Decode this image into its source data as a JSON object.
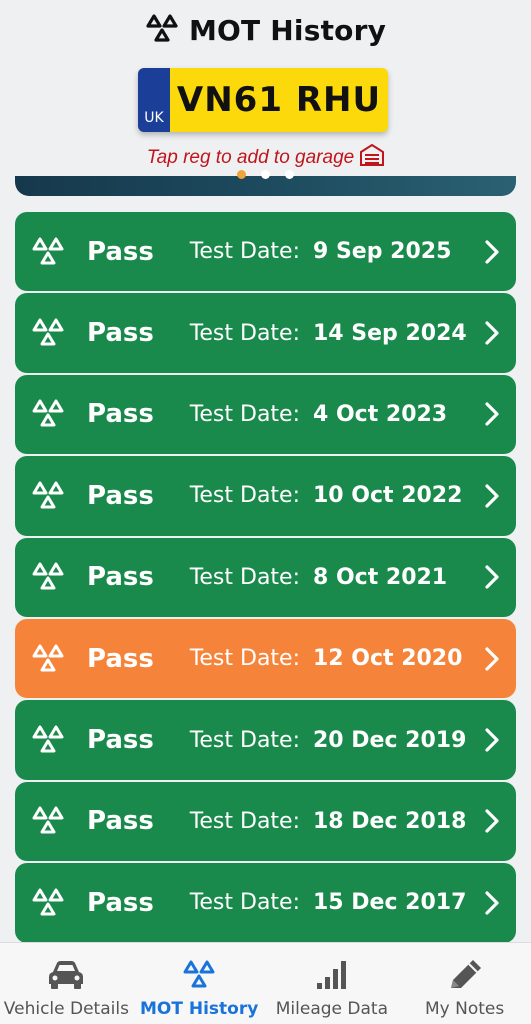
{
  "header": {
    "title": "MOT History"
  },
  "plate": {
    "country": "UK",
    "registration": "VN61 RHU"
  },
  "hint": {
    "text": "Tap reg to add to garage"
  },
  "carousel": {
    "page_count": 3,
    "active_index": 0
  },
  "tests": [
    {
      "result": "Pass",
      "label": "Test Date:",
      "date": "9 Sep 2025",
      "color": "#198a4b"
    },
    {
      "result": "Pass",
      "label": "Test Date:",
      "date": "14 Sep 2024",
      "color": "#198a4b"
    },
    {
      "result": "Pass",
      "label": "Test Date:",
      "date": "4 Oct 2023",
      "color": "#198a4b"
    },
    {
      "result": "Pass",
      "label": "Test Date:",
      "date": "10 Oct 2022",
      "color": "#198a4b"
    },
    {
      "result": "Pass",
      "label": "Test Date:",
      "date": "8 Oct 2021",
      "color": "#198a4b"
    },
    {
      "result": "Pass",
      "label": "Test Date:",
      "date": "12 Oct 2020",
      "color": "#f5843a"
    },
    {
      "result": "Pass",
      "label": "Test Date:",
      "date": "20 Dec 2019",
      "color": "#198a4b"
    },
    {
      "result": "Pass",
      "label": "Test Date:",
      "date": "18 Dec 2018",
      "color": "#198a4b"
    },
    {
      "result": "Pass",
      "label": "Test Date:",
      "date": "15 Dec 2017",
      "color": "#198a4b"
    }
  ],
  "nav": {
    "items": [
      {
        "label": "Vehicle Details",
        "icon": "car-icon",
        "active": false
      },
      {
        "label": "MOT History",
        "icon": "mot-triangle-icon",
        "active": true
      },
      {
        "label": "Mileage Data",
        "icon": "bar-chart-icon",
        "active": false
      },
      {
        "label": "My Notes",
        "icon": "pencil-icon",
        "active": false
      }
    ]
  },
  "colors": {
    "pass": "#198a4b",
    "advisory": "#f5843a",
    "accent": "#1a73d9",
    "plate_yellow": "#fbd90b",
    "plate_blue": "#1b3f99",
    "hint_red": "#c0151b"
  }
}
